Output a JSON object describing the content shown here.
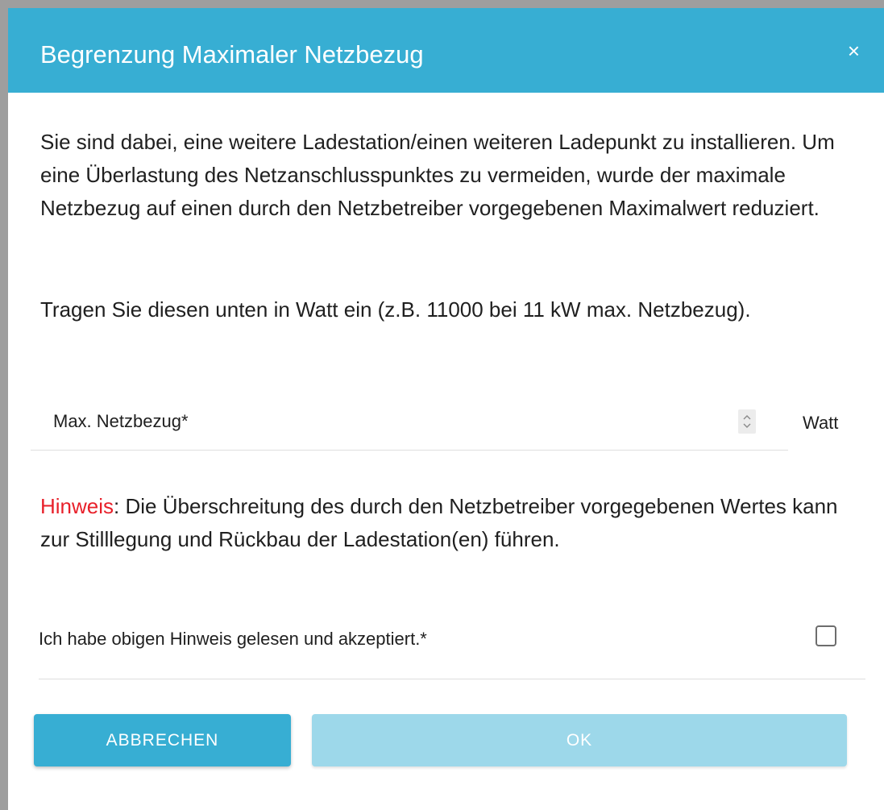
{
  "dialog": {
    "title": "Begrenzung Maximaler Netzbezug",
    "close_label": "×",
    "paragraph1": "Sie sind dabei, eine weitere Ladestation/einen weiteren Ladepunkt zu installieren. Um eine Überlastung des Netzanschlusspunktes zu vermeiden, wurde der maximale Netzbezug auf einen durch den Netzbetreiber vorgegebenen Maximalwert reduziert.",
    "paragraph2": "Tragen Sie diesen unten in Watt ein (z.B. 11000 bei 11 kW max. Netzbezug).",
    "field": {
      "label": "Max. Netzbezug*",
      "value": "",
      "unit": "Watt"
    },
    "note": {
      "hint_word": "Hinweis",
      "text": ": Die Überschreitung des durch den Netzbetreiber vorgegebenen Wertes kann zur Stilllegung und Rückbau der Ladestation(en) führen."
    },
    "acknowledge": {
      "label": "Ich habe obigen Hinweis gelesen und akzeptiert.*",
      "checked": false
    },
    "buttons": {
      "cancel": "ABBRECHEN",
      "ok": "OK"
    }
  },
  "colors": {
    "header": "#37aed3",
    "button_primary": "#37aed3",
    "button_disabled": "#9dd8ea",
    "hint": "#e8202a"
  },
  "icons": {
    "close": "close-icon",
    "spinner": "spinner-arrows-icon"
  }
}
